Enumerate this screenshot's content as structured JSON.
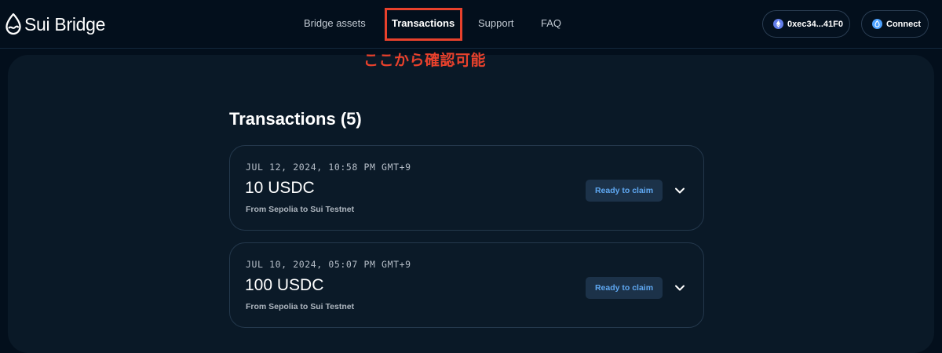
{
  "brand": {
    "name": "Sui Bridge"
  },
  "nav": {
    "items": [
      {
        "label": "Bridge assets",
        "active": false
      },
      {
        "label": "Transactions",
        "active": true
      },
      {
        "label": "Support",
        "active": false
      },
      {
        "label": "FAQ",
        "active": false
      }
    ]
  },
  "annotation": {
    "text": "ここから確認可能",
    "color": "#e8412c"
  },
  "wallet": {
    "address": "0xec34...41F0",
    "icon": "ethereum-icon"
  },
  "connect": {
    "label": "Connect",
    "icon": "sui-icon"
  },
  "main": {
    "title": "Transactions (5)",
    "transactions": [
      {
        "date": "JUL 12, 2024, 10:58 PM GMT+9",
        "amount": "10 USDC",
        "route": "From Sepolia to Sui Testnet",
        "status": "Ready to claim"
      },
      {
        "date": "JUL 10, 2024, 05:07 PM GMT+9",
        "amount": "100 USDC",
        "route": "From Sepolia to Sui Testnet",
        "status": "Ready to claim"
      }
    ]
  },
  "colors": {
    "background": "#030f1c",
    "panel": "#0a1927",
    "accent_blue": "#5fa8f2",
    "badge_bg": "#1c3249",
    "highlight_red": "#e8412c"
  }
}
